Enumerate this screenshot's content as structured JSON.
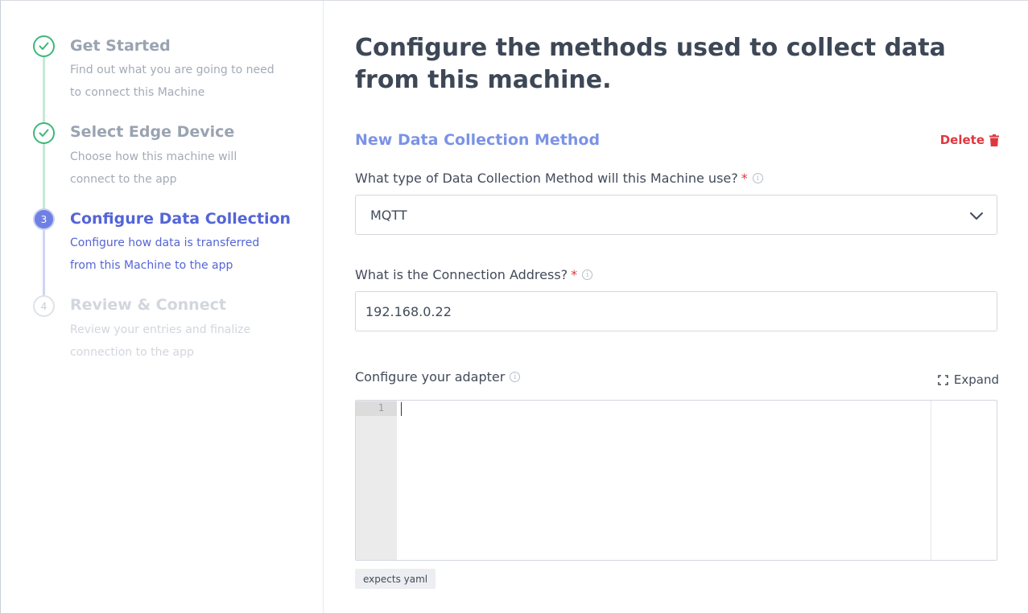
{
  "sidebar": {
    "steps": [
      {
        "number": "1",
        "title": "Get Started",
        "description": "Find out what you are going to need to connect this Machine",
        "state": "done"
      },
      {
        "number": "2",
        "title": "Select Edge Device",
        "description": "Choose how this machine will connect to the app",
        "state": "done"
      },
      {
        "number": "3",
        "title": "Configure Data Collection",
        "description": "Configure how data is transferred from this Machine to the app",
        "state": "active"
      },
      {
        "number": "4",
        "title": "Review & Connect",
        "description": "Review your entries and finalize connection to the app",
        "state": "todo"
      }
    ]
  },
  "main": {
    "title": "Configure the methods used to collect data from this machine.",
    "section_title": "New Data Collection Method",
    "delete_label": "Delete",
    "method_question": "What type of Data Collection Method will this Machine use?",
    "method_value": "MQTT",
    "address_question": "What is the Connection Address?",
    "address_value": "192.168.0.22",
    "required_mark": "*",
    "adapter_label": "Configure your adapter",
    "expand_label": "Expand",
    "editor_line_number": "1",
    "editor_badge": "expects yaml",
    "info_glyph": "i"
  },
  "colors": {
    "done": "#3cb878",
    "active": "#5465d6",
    "section_title": "#7b93e6",
    "delete": "#e0373f"
  },
  "icons": {
    "step_done": "check-circle-icon",
    "delete": "trash-icon",
    "select": "chevron-down-icon",
    "info": "info-icon",
    "expand": "expand-icon"
  }
}
